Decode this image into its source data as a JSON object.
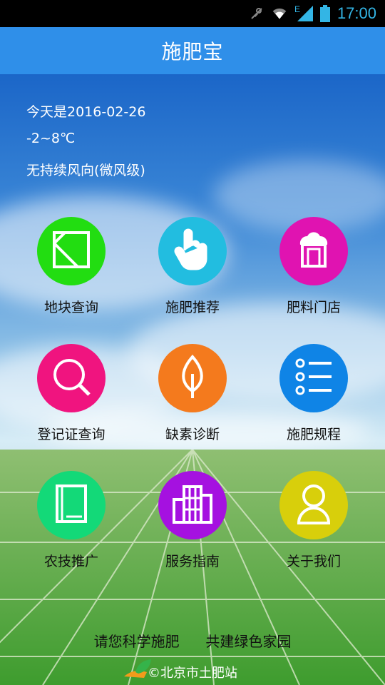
{
  "status_bar": {
    "time": "17:00",
    "icons": [
      "mute-icon",
      "wifi-icon",
      "signal-icon",
      "battery-icon"
    ],
    "network_type": "E"
  },
  "app_bar": {
    "title": "施肥宝"
  },
  "weather": {
    "date": "今天是2016-02-26",
    "temperature": "-2~8℃",
    "wind": "无持续风向(微风级)"
  },
  "menu": [
    {
      "label": "地块查询",
      "color": "#22dd11",
      "icon": "map-plot-icon"
    },
    {
      "label": "施肥推荐",
      "color": "#22bde0",
      "icon": "hand-pointer-icon"
    },
    {
      "label": "肥料门店",
      "color": "#e013b1",
      "icon": "store-icon"
    },
    {
      "label": "登记证查询",
      "color": "#f0147f",
      "icon": "search-icon"
    },
    {
      "label": "缺素诊断",
      "color": "#f47a1d",
      "icon": "leaf-icon"
    },
    {
      "label": "施肥规程",
      "color": "#0f84e6",
      "icon": "list-icon"
    },
    {
      "label": "农技推广",
      "color": "#13d978",
      "icon": "book-icon"
    },
    {
      "label": "服务指南",
      "color": "#a511e0",
      "icon": "building-icon"
    },
    {
      "label": "关于我们",
      "color": "#d8cf0b",
      "icon": "person-icon"
    }
  ],
  "footer": {
    "slogan": "请您科学施肥  共建绿色家园",
    "copyright": "©北京市土肥站"
  }
}
